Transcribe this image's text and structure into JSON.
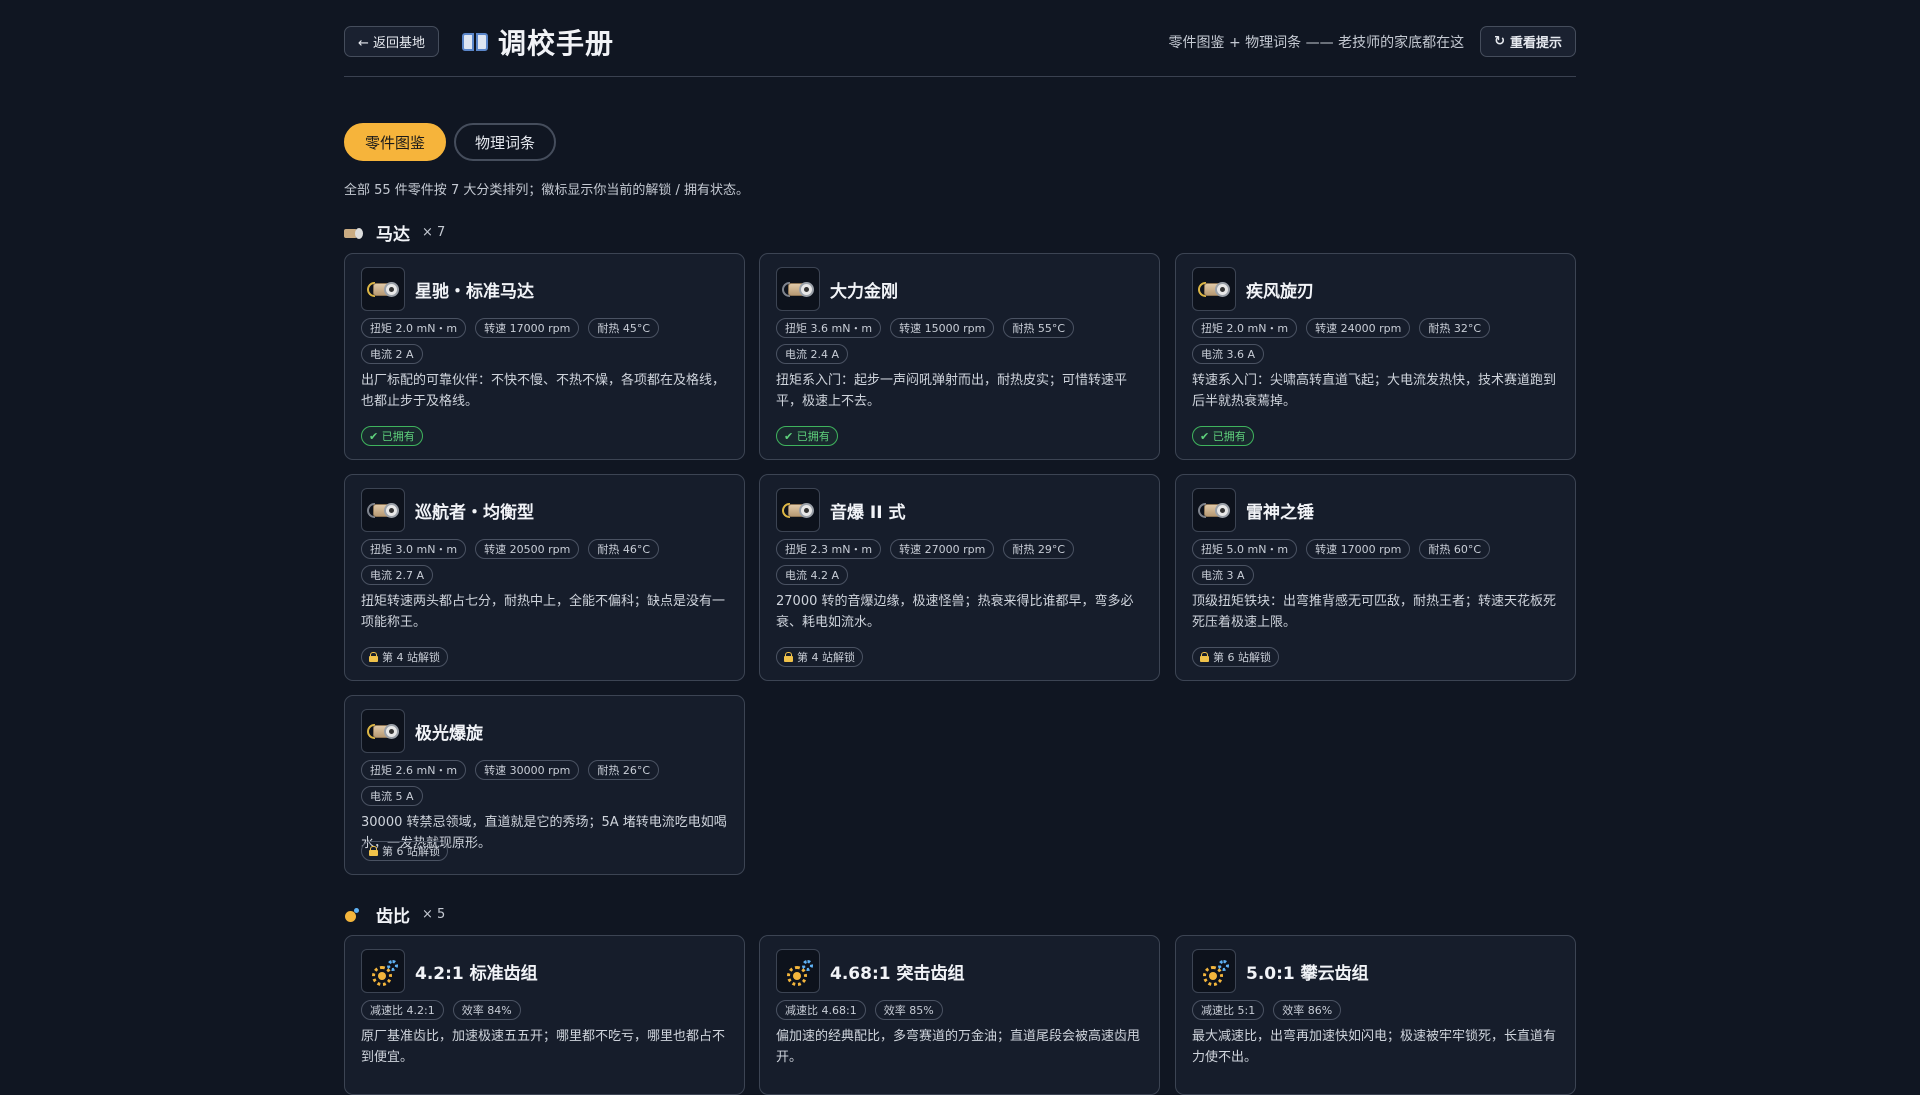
{
  "header": {
    "back_label": "← 返回基地",
    "title": "调校手册",
    "subtitle": "零件图鉴 + 物理词条 —— 老技师的家底都在这",
    "hint_label": "重看提示"
  },
  "tabs": [
    {
      "label": "零件图鉴",
      "active": true
    },
    {
      "label": "物理词条",
      "active": false
    }
  ],
  "intro": "全部 55 件零件按 7 大分类排列；徽标显示你当前的解锁 / 拥有状态。",
  "sections": [
    {
      "name": "马达",
      "count": "× 7",
      "icon": "motor-icon",
      "items": [
        {
          "name": "星驰・标准马达",
          "chips": [
            "扭矩 2.0 mN・m",
            "转速 17000 rpm",
            "耐热 45°C",
            "电流 2 A"
          ],
          "desc": "出厂标配的可靠伙伴：不快不慢、不热不燥，各项都在及格线，也都止步于及格线。",
          "badge": "✔ 已拥有",
          "status": "owned"
        },
        {
          "name": "大力金刚",
          "chips": [
            "扭矩 3.6 mN・m",
            "转速 15000 rpm",
            "耐热 55°C",
            "电流 2.4 A"
          ],
          "desc": "扭矩系入门：起步一声闷吼弹射而出，耐热皮实；可惜转速平平，极速上不去。",
          "badge": "✔ 已拥有",
          "status": "owned"
        },
        {
          "name": "疾风旋刃",
          "chips": [
            "扭矩 2.0 mN・m",
            "转速 24000 rpm",
            "耐热 32°C",
            "电流 3.6 A"
          ],
          "desc": "转速系入门：尖啸高转直道飞起；大电流发热快，技术赛道跑到后半就热衰蔫掉。",
          "badge": "✔ 已拥有",
          "status": "owned"
        },
        {
          "name": "巡航者・均衡型",
          "chips": [
            "扭矩 3.0 mN・m",
            "转速 20500 rpm",
            "耐热 46°C",
            "电流 2.7 A"
          ],
          "desc": "扭矩转速两头都占七分，耐热中上，全能不偏科；缺点是没有一项能称王。",
          "badge": "第 4 站解锁",
          "status": "locked"
        },
        {
          "name": "音爆 II 式",
          "chips": [
            "扭矩 2.3 mN・m",
            "转速 27000 rpm",
            "耐热 29°C",
            "电流 4.2 A"
          ],
          "desc": "27000 转的音爆边缘，极速怪兽；热衰来得比谁都早，弯多必衰、耗电如流水。",
          "badge": "第 4 站解锁",
          "status": "locked"
        },
        {
          "name": "雷神之锤",
          "chips": [
            "扭矩 5.0 mN・m",
            "转速 17000 rpm",
            "耐热 60°C",
            "电流 3 A"
          ],
          "desc": "顶级扭矩铁块：出弯推背感无可匹敌，耐热王者；转速天花板死死压着极速上限。",
          "badge": "第 6 站解锁",
          "status": "locked"
        },
        {
          "name": "极光爆旋",
          "chips": [
            "扭矩 2.6 mN・m",
            "转速 30000 rpm",
            "耐热 26°C",
            "电流 5 A"
          ],
          "desc": "30000 转禁忌领域，直道就是它的秀场；5A 堵转电流吃电如喝水，一发热就现原形。",
          "badge": "第 6 站解锁",
          "status": "locked"
        }
      ]
    },
    {
      "name": "齿比",
      "count": "× 5",
      "icon": "gear-icon",
      "items": [
        {
          "name": "4.2:1 标准齿组",
          "chips": [
            "减速比 4.2:1",
            "效率 84%"
          ],
          "desc": "原厂基准齿比，加速极速五五开；哪里都不吃亏，哪里也都占不到便宜。",
          "badge": "",
          "status": ""
        },
        {
          "name": "4.68:1 突击齿组",
          "chips": [
            "减速比 4.68:1",
            "效率 85%"
          ],
          "desc": "偏加速的经典配比，多弯赛道的万金油；直道尾段会被高速齿甩开。",
          "badge": "",
          "status": ""
        },
        {
          "name": "5.0:1 攀云齿组",
          "chips": [
            "减速比 5:1",
            "效率 86%"
          ],
          "desc": "最大减速比，出弯再加速快如闪电；极速被牢牢锁死，长直道有力使不出。",
          "badge": "",
          "status": ""
        }
      ]
    }
  ]
}
